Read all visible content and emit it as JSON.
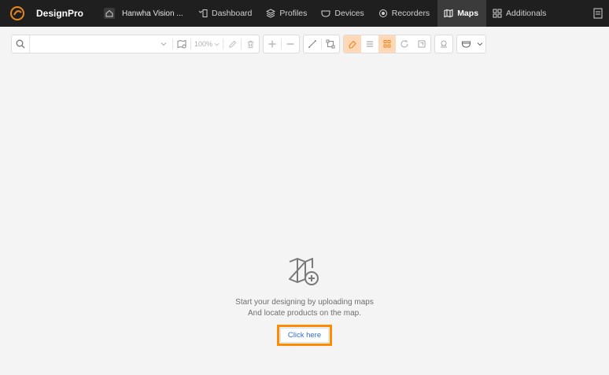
{
  "app": {
    "name": "DesignPro",
    "accent": "#e8871e"
  },
  "header": {
    "project_name": "Hanwha Vision ...",
    "nav": [
      {
        "label": "Dashboard",
        "icon": "dashboard-icon"
      },
      {
        "label": "Profiles",
        "icon": "profiles-icon"
      },
      {
        "label": "Devices",
        "icon": "camera-icon"
      },
      {
        "label": "Recorders",
        "icon": "recorder-icon"
      },
      {
        "label": "Maps",
        "icon": "map-icon",
        "active": true
      },
      {
        "label": "Additionals",
        "icon": "grid-icon"
      }
    ]
  },
  "toolbar": {
    "search": {
      "value": "",
      "placeholder": ""
    },
    "zoom": "100%",
    "highlight_color": "#ffd8b8"
  },
  "empty_state": {
    "line1": "Start your designing by uploading maps",
    "line2": "And locate products on the map.",
    "button_label": "Click here",
    "highlight_border": "#ff8c00"
  }
}
